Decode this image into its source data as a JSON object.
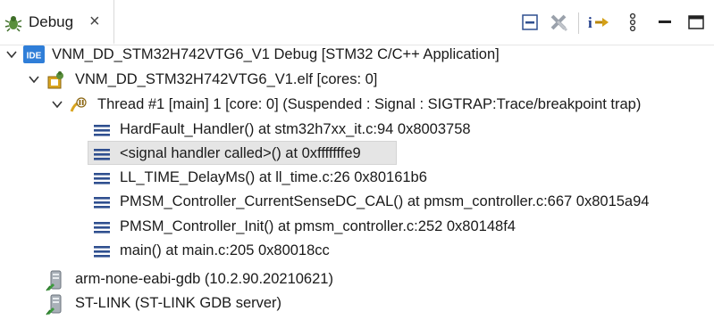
{
  "tab": {
    "title": "Debug",
    "close_glyph": "×"
  },
  "toolbar": {
    "buttons": [
      {
        "name": "collapse-all-icon"
      },
      {
        "name": "remove-all-terminated-icon"
      },
      {
        "name": "step-into-icon"
      },
      {
        "name": "view-menu-icon"
      },
      {
        "name": "minimize-icon"
      },
      {
        "name": "maximize-icon"
      }
    ]
  },
  "tree": {
    "launch_label": "VNM_DD_STM32H742VTG6_V1 Debug [STM32 C/C++ Application]",
    "launch_badge": "IDE",
    "elf_label": "VNM_DD_STM32H742VTG6_V1.elf [cores: 0]",
    "thread_label": "Thread #1 [main] 1 [core: 0] (Suspended : Signal : SIGTRAP:Trace/breakpoint trap)",
    "frames": [
      "HardFault_Handler() at stm32h7xx_it.c:94 0x8003758",
      "<signal handler called>() at 0xfffffffe9",
      "LL_TIME_DelayMs() at ll_time.c:26 0x80161b6",
      "PMSM_Controller_CurrentSenseDC_CAL() at pmsm_controller.c:667 0x8015a94",
      "PMSM_Controller_Init() at pmsm_controller.c:252 0x80148f4",
      "main() at main.c:205 0x80018cc"
    ],
    "gdb_label": "arm-none-eabi-gdb (10.2.90.20210621)",
    "stlink_label": "ST-LINK (ST-LINK GDB server)"
  }
}
